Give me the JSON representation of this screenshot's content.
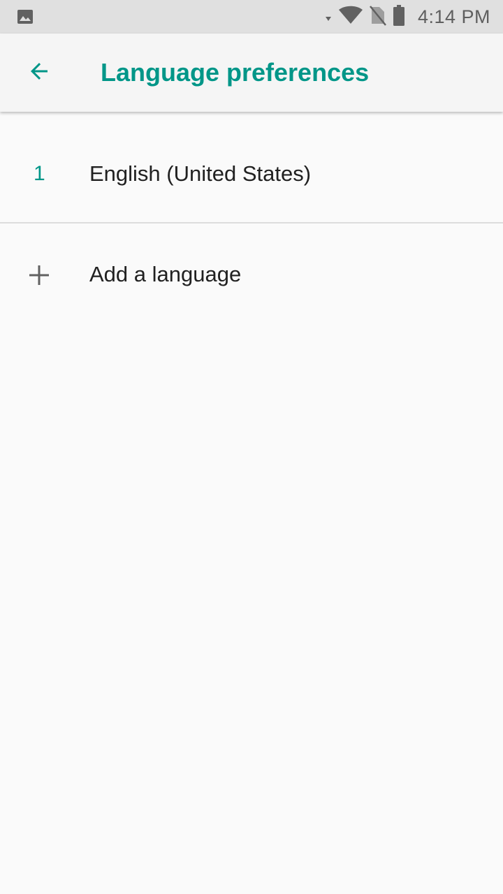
{
  "status_bar": {
    "left_icon": "image-icon",
    "right_icons": [
      "wifi-icon",
      "no-sim-icon",
      "battery-icon"
    ],
    "time": "4:14 PM"
  },
  "app_bar": {
    "back_icon": "arrow-back-icon",
    "title": "Language preferences"
  },
  "languages": [
    {
      "index": "1",
      "name": "English (United States)"
    }
  ],
  "add_language": {
    "icon": "plus-icon",
    "label": "Add a language"
  },
  "colors": {
    "accent": "#009688",
    "status_bar_bg": "#e0e0e0",
    "app_bar_bg": "#f5f5f5",
    "page_bg": "#fafafa",
    "primary_text": "#212121",
    "icon_gray": "#616161"
  }
}
